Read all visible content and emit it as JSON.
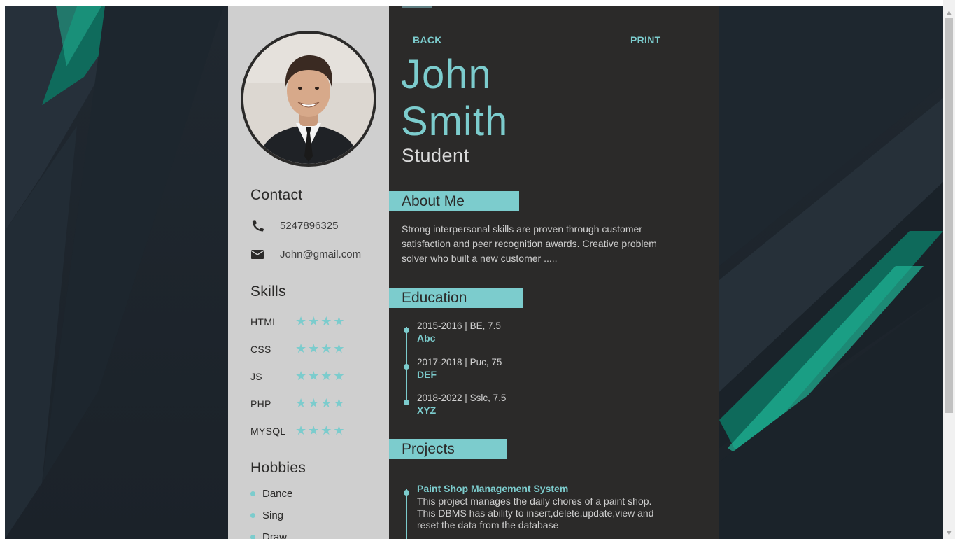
{
  "colors": {
    "accent": "#7ccccd",
    "sidebar_bg": "#cfcfcf",
    "main_bg": "#2b2a29",
    "page_bg": "#1c232b"
  },
  "nav": {
    "back": "BACK",
    "print": "PRINT"
  },
  "profile": {
    "first_name": "John",
    "last_name": "Smith",
    "role": "Student"
  },
  "contact": {
    "heading": "Contact",
    "phone": "5247896325",
    "email": "John@gmail.com",
    "phone_icon": "phone-icon",
    "email_icon": "envelope-icon"
  },
  "skills": {
    "heading": "Skills",
    "items": [
      {
        "name": "HTML",
        "rating": 4
      },
      {
        "name": "CSS",
        "rating": 4
      },
      {
        "name": "JS",
        "rating": 4
      },
      {
        "name": "PHP",
        "rating": 4
      },
      {
        "name": "MYSQL",
        "rating": 4
      }
    ]
  },
  "hobbies": {
    "heading": "Hobbies",
    "items": [
      "Dance",
      "Sing",
      "Draw"
    ]
  },
  "about": {
    "heading": "About Me",
    "text": "Strong interpersonal skills are proven through customer satisfaction and peer recognition awards. Creative problem solver who built a new customer ....."
  },
  "education": {
    "heading": "Education",
    "items": [
      {
        "year": "2015-2016 | BE, 7.5",
        "school": "Abc"
      },
      {
        "year": "2017-2018 | Puc, 75",
        "school": "DEF"
      },
      {
        "year": "2018-2022 | Sslc, 7.5",
        "school": "XYZ"
      }
    ]
  },
  "projects": {
    "heading": "Projects",
    "items": [
      {
        "title": "Paint Shop Management System",
        "description": "This project manages the daily chores of a paint shop. This DBMS has ability to insert,delete,update,view and reset the data from the database"
      }
    ]
  }
}
